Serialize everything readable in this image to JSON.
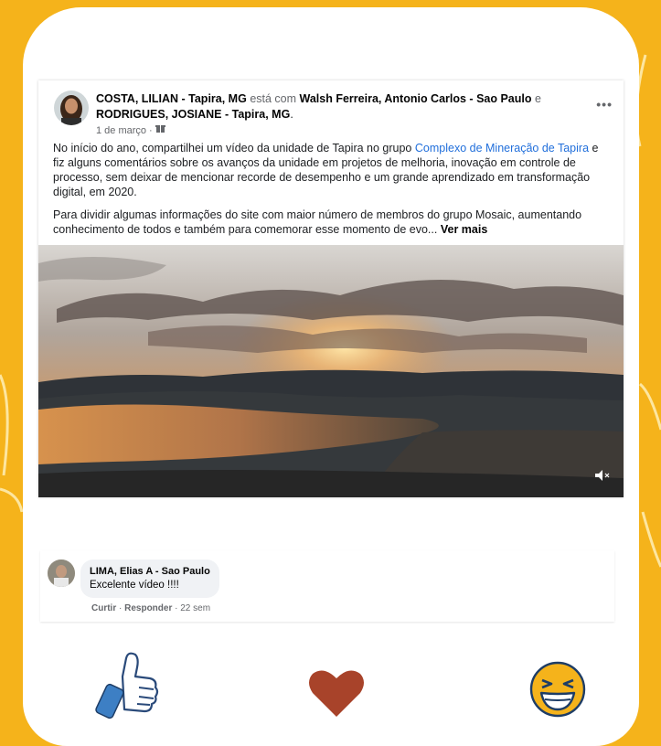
{
  "post": {
    "author": "COSTA, LILIAN - Tapira, MG",
    "with_word": "está com",
    "tagged_1": "Walsh Ferreira, Antonio Carlos - Sao Paulo",
    "and_word": "e",
    "tagged_2": "RODRIGUES, JOSIANE - Tapira, MG",
    "period": ".",
    "date": "1 de março",
    "dot": "·",
    "more_icon": "more-horizontal-icon",
    "para1_a": "No início do ano, compartilhei um vídeo da unidade de Tapira no grupo ",
    "para1_link": "Complexo de Mineração de Tapira",
    "para1_b": " e fiz alguns comentários sobre os avanços da unidade em projetos de melhoria, inovação em controle de processo, sem deixar de mencionar recorde de desempenho e um grande aprendizado em transformação digital, em 2020.",
    "para2": "Para dividir algumas informações do site com maior número de membros do grupo Mosaic, aumentando conhecimento de todos e também para comemorar esse momento de evo...",
    "see_more": "Ver mais"
  },
  "comment": {
    "author": "LIMA, Elias A - Sao Paulo",
    "text": "Excelente vídeo !!!!",
    "like": "Curtir",
    "reply": "Responder",
    "time": "22 sem",
    "sep": " · "
  },
  "colors": {
    "background": "#f5b31b",
    "heart": "#a8432a",
    "thumb_cuff": "#3d7fc4",
    "link": "#216fdb"
  }
}
